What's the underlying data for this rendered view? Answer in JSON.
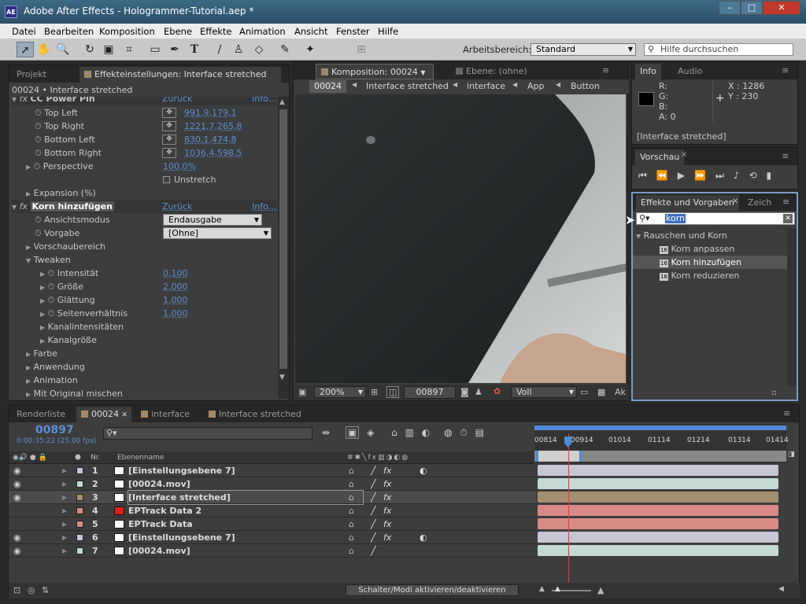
{
  "title": "Adobe After Effects - Hologrammer-Tutorial.aep *",
  "app_icon": "AE",
  "menu": [
    "Datei",
    "Bearbeiten",
    "Komposition",
    "Ebene",
    "Effekte",
    "Animation",
    "Ansicht",
    "Fenster",
    "Hilfe"
  ],
  "toolbar": {
    "workspace_label": "Arbeitsbereich:",
    "workspace_value": "Standard",
    "search_placeholder": "Hilfe durchsuchen"
  },
  "left_panel": {
    "tab_project": "Projekt",
    "tab_effects": "Effekteinstellungen: Interface stretched",
    "header": "00024 • Interface stretched",
    "cc_power_pin": {
      "name": "CC Power Pin",
      "reset": "Zurück",
      "info": "Info..."
    },
    "pins": [
      {
        "label": "Top Left",
        "value": "991,9,179,1"
      },
      {
        "label": "Top Right",
        "value": "1221,7,265,8"
      },
      {
        "label": "Bottom Left",
        "value": "830,1,474,8"
      },
      {
        "label": "Bottom Right",
        "value": "1036,4,598,5"
      }
    ],
    "perspective": {
      "label": "Perspective",
      "value": "100,0%"
    },
    "unstretch": "Unstretch",
    "expansion": "Expansion (%)",
    "korn": {
      "name": "Korn hinzufügen",
      "reset": "Zurück",
      "info": "Info..."
    },
    "ansichtsmodus": {
      "label": "Ansichtsmodus",
      "value": "Endausgabe"
    },
    "vorgabe": {
      "label": "Vorgabe",
      "value": "[Ohne]"
    },
    "vorschaubereich": "Vorschaubereich",
    "tweaken": "Tweaken",
    "tweak_items": [
      {
        "label": "Intensität",
        "value": "0,100"
      },
      {
        "label": "Größe",
        "value": "2,000"
      },
      {
        "label": "Glättung",
        "value": "1,000"
      },
      {
        "label": "Seitenverhältnis",
        "value": "1,000"
      }
    ],
    "kanalintensitaeten": "Kanalintensitäten",
    "kanalgroesse": "Kanalgröße",
    "farbe": "Farbe",
    "anwendung": "Anwendung",
    "animation": "Animation",
    "mit_original": "Mit Original mischen"
  },
  "comp_panel": {
    "tab_comp": "Komposition: 00024",
    "tab_layer": "Ebene: (ohne)",
    "breadcrumbs": [
      "00024",
      "Interface stretched",
      "interface",
      "App",
      "Button"
    ],
    "zoom": "200%",
    "timecode": "00897",
    "quality": "Voll",
    "cut": "Ak"
  },
  "info_panel": {
    "tab_info": "Info",
    "tab_audio": "Audio",
    "r": "R:",
    "g": "G:",
    "b": "B:",
    "a": "A:  0",
    "x": "X : 1286",
    "y": "Y : 230",
    "layer": "[Interface stretched]"
  },
  "preview_panel": {
    "tab": "Vorschau"
  },
  "effects_panel": {
    "tab": "Effekte und Vorgaben",
    "tab2": "Zeich",
    "search": "korn",
    "category": "Rauschen und Korn",
    "items": [
      "Korn anpassen",
      "Korn hinzufügen",
      "Korn reduzieren"
    ]
  },
  "timeline": {
    "tabs": [
      "Renderliste",
      "00024",
      "interface",
      "Interface stretched"
    ],
    "timecode": "00897",
    "timecode_sub": "0:00:35:22 (25.00 fps)",
    "col_nr": "Nr.",
    "col_name": "Ebenenname",
    "ruler": [
      "00814",
      "00914",
      "01014",
      "01114",
      "01214",
      "01314",
      "01414"
    ],
    "current_frame_fraction": 0.133,
    "layers": [
      {
        "nr": "1",
        "name": "[Einstellungsebene 7]",
        "color": "#ffffff",
        "bar": "#c6c6d4"
      },
      {
        "nr": "2",
        "name": "[00024.mov]",
        "color": "#ffffff",
        "bar": "#c4d8d4"
      },
      {
        "nr": "3",
        "name": "[Interface stretched]",
        "color": "#ffffff",
        "bar": "#a48e70"
      },
      {
        "nr": "4",
        "name": "EPTrack Data 2",
        "color": "#e02020",
        "bar": "#d88a86"
      },
      {
        "nr": "5",
        "name": "EPTrack Data",
        "color": "#ffffff",
        "bar": "#d88a86"
      },
      {
        "nr": "6",
        "name": "[Einstellungsebene 7]",
        "color": "#ffffff",
        "bar": "#c6c6d4"
      },
      {
        "nr": "7",
        "name": "[00024.mov]",
        "color": "#ffffff",
        "bar": "#c4d8d4"
      }
    ],
    "toggle_label": "Schalter/Modi aktivieren/deaktivieren"
  }
}
